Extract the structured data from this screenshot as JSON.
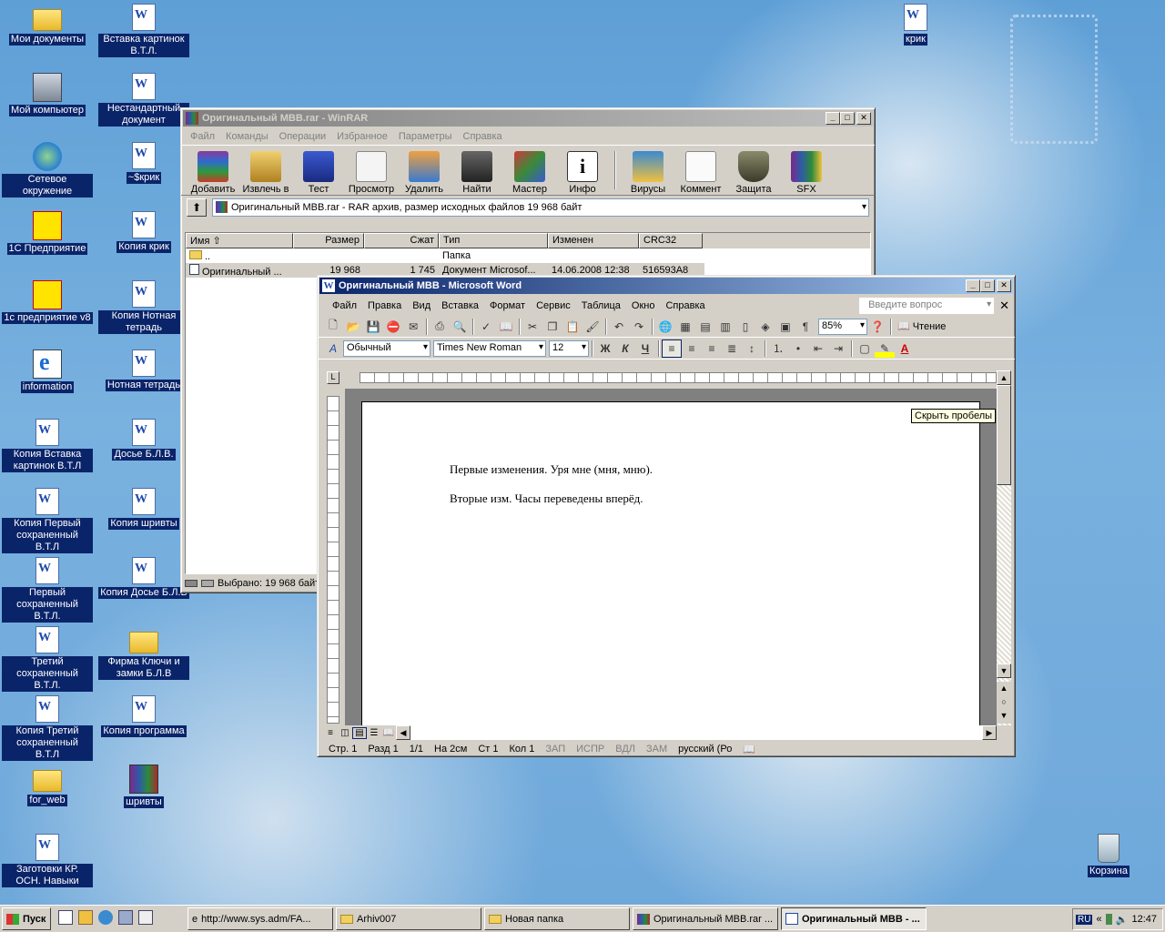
{
  "desktop_icons": {
    "my_documents": "Мои документы",
    "vstavka_kartinok": "Вставка картинок В.Т.Л.",
    "krik": "крик",
    "my_computer": "Мой компьютер",
    "nestandartny": "Нестандартный документ",
    "network": "Сетевое окружение",
    "tmp_krik": "~$крик",
    "predpriyatie": "1С Предприятие",
    "kopiya_krik": "Копия крик",
    "predpriyatie_v8": "1с предприятие v8",
    "kopiya_notnaya": "Копия Нотная тетрадь",
    "information": "information",
    "notnaya": "Нотная тетрадь",
    "kopiya_vstavka": "Копия Вставка картинок В.Т.Л",
    "dosye": "Досье Б.Л.В.",
    "kopiya_pervy": "Копия Первый сохраненный В.Т.Л",
    "kopiya_shrivty": "Копия шривты",
    "pervy": "Первый сохраненный В.Т.Л.",
    "kopiya_dosye": "Копия Досье Б.Л.В",
    "tretiy": "Третий сохраненный В.Т.Л.",
    "firma": "Фирма Ключи и замки Б.Л.В",
    "kopiya_tretiy": "Копия Третий сохраненный В.Т.Л",
    "kopiya_programma": "Копия программа",
    "for_web": "for_web",
    "shrivty": "шривты",
    "zagotovki": "Заготовки КР. ОСН. Навыки",
    "recycle": "Корзина"
  },
  "winrar": {
    "title": "Оригинальный МВВ.rar - WinRAR",
    "menu": [
      "Файл",
      "Команды",
      "Операции",
      "Избранное",
      "Параметры",
      "Справка"
    ],
    "toolbar": [
      "Добавить",
      "Извлечь в",
      "Тест",
      "Просмотр",
      "Удалить",
      "Найти",
      "Мастер",
      "Инфо",
      "Вирусы",
      "Коммент",
      "Защита",
      "SFX"
    ],
    "path": "Оригинальный МВВ.rar - RAR архив, размер исходных файлов 19 968 байт",
    "columns": [
      "Имя",
      "Размер",
      "Сжат",
      "Тип",
      "Изменен",
      "CRC32"
    ],
    "rows": [
      {
        "name": "..",
        "size": "",
        "packed": "",
        "type": "Папка",
        "modified": "",
        "crc": ""
      },
      {
        "name": "Оригинальный ...",
        "size": "19 968",
        "packed": "1 745",
        "type": "Документ Microsof...",
        "modified": "14.06.2008 12:38",
        "crc": "516593A8"
      }
    ],
    "status": "Выбрано: 19 968 байт"
  },
  "word": {
    "title": "Оригинальный МВВ - Microsoft Word",
    "menu": [
      "Файл",
      "Правка",
      "Вид",
      "Вставка",
      "Формат",
      "Сервис",
      "Таблица",
      "Окно",
      "Справка"
    ],
    "ask_placeholder": "Введите вопрос",
    "zoom": "85%",
    "reading": "Чтение",
    "style": "Обычный",
    "font": "Times New Roman",
    "size": "12",
    "bold": "Ж",
    "italic": "К",
    "underline": "Ч",
    "tooltip": "Скрыть пробелы",
    "line1": "Первые изменения. Уря мне (мня, мню).",
    "line2": "Вторые изм. Часы переведены вперёд.",
    "status": {
      "page": "Стр.  1",
      "section": "Разд  1",
      "pages": "1/1",
      "at": "На  2см",
      "line": "Ст  1",
      "col": "Кол  1",
      "rec": "ЗАП",
      "trk": "ИСПР",
      "ext": "ВДЛ",
      "ovr": "ЗАМ",
      "lang": "русский (Ро"
    }
  },
  "taskbar": {
    "start": "Пуск",
    "tasks": [
      "http://www.sys.adm/FA...",
      "Arhiv007",
      "Новая папка",
      "Оригинальный МВВ.rar ...",
      "Оригинальный МВВ - ..."
    ],
    "lang": "RU",
    "clock": "12:47"
  }
}
